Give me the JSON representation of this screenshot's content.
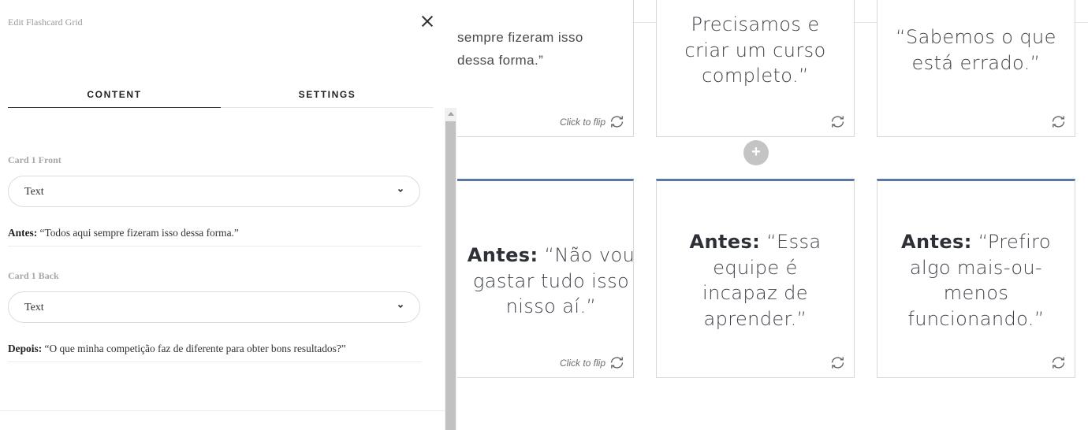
{
  "panel": {
    "title": "Edit Flashcard Grid",
    "close_icon": "close-icon",
    "tabs": [
      {
        "label": "CONTENT",
        "active": true
      },
      {
        "label": "SETTINGS",
        "active": false
      }
    ],
    "card1_front": {
      "label": "Card 1 Front",
      "type_value": "Text",
      "text_prefix": "Antes:",
      "text_body": " “Todos aqui sempre fizeram isso dessa forma.”"
    },
    "card1_back": {
      "label": "Card 1 Back",
      "type_value": "Text",
      "text_prefix": "Depois:",
      "text_body": " “O que minha competição faz de diferente para obter bons resultados?”"
    }
  },
  "cards": {
    "c1": {
      "line1": "sempre fizeram isso",
      "line2": "dessa forma.”",
      "flip": "Click to flip"
    },
    "c2": {
      "line1": "Precisamos e",
      "line2": "criar um curso",
      "line3": "completo.”"
    },
    "c3": {
      "line1": "“Sabemos o que",
      "line2": "está errado.”"
    },
    "c4": {
      "bold": "Antes:",
      "line1": " “Não vou",
      "line2": "gastar tudo isso",
      "line3": "nisso aí.”",
      "flip": "Click to flip"
    },
    "c5": {
      "bold": "Antes:",
      "line1": " “Essa",
      "line2": "equipe é",
      "line3": "incapaz de",
      "line4": "aprender.”"
    },
    "c6": {
      "bold": "Antes:",
      "line1": " “Prefiro",
      "line2": "algo mais-ou-",
      "line3": "menos",
      "line4": "funcionando.”"
    }
  },
  "add_button": "+",
  "colors": {
    "card_accent": "#5b77a3",
    "add_button": "#c4c4c4"
  },
  "icons": {
    "flip": "refresh-icon",
    "chevron": "chevron-down-icon"
  }
}
